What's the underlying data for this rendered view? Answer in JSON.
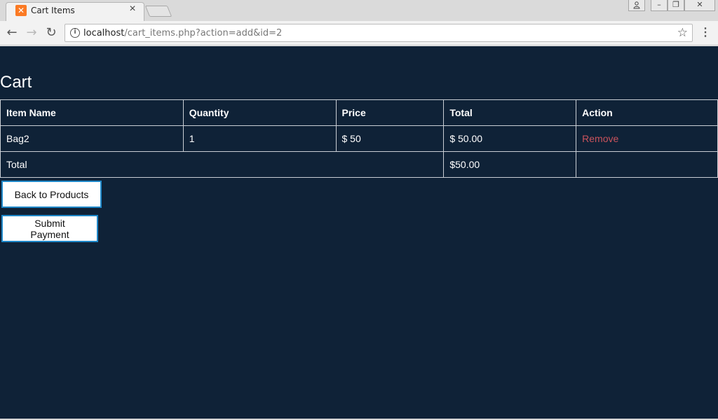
{
  "browser": {
    "tab": {
      "title": "Cart Items",
      "favicon": "xampp-icon",
      "close_glyph": "×"
    },
    "window_controls": {
      "user": "user-icon",
      "minimize": "–",
      "restore": "❐",
      "close": "✕"
    },
    "nav": {
      "back": "←",
      "forward": "→",
      "reload": "↻"
    },
    "address": {
      "host": "localhost",
      "path": "/cart_items.php?action=add&id=2"
    },
    "star_glyph": "☆",
    "menu_glyph": "⋮"
  },
  "page": {
    "heading": "Cart",
    "table": {
      "headers": [
        "Item Name",
        "Quantity",
        "Price",
        "Total",
        "Action"
      ],
      "rows": [
        {
          "item": "Bag2",
          "quantity": "1",
          "price": "$ 50",
          "total": "$ 50.00",
          "action": "Remove"
        }
      ],
      "footer": {
        "label": "Total",
        "total": "$50.00",
        "action": ""
      }
    },
    "buttons": {
      "back": "Back to Products",
      "submit": "Submit Payment"
    },
    "colors": {
      "background": "#0f2237",
      "text": "#ffffff",
      "link": "#c9535c",
      "button_border": "#1f88c9"
    }
  }
}
